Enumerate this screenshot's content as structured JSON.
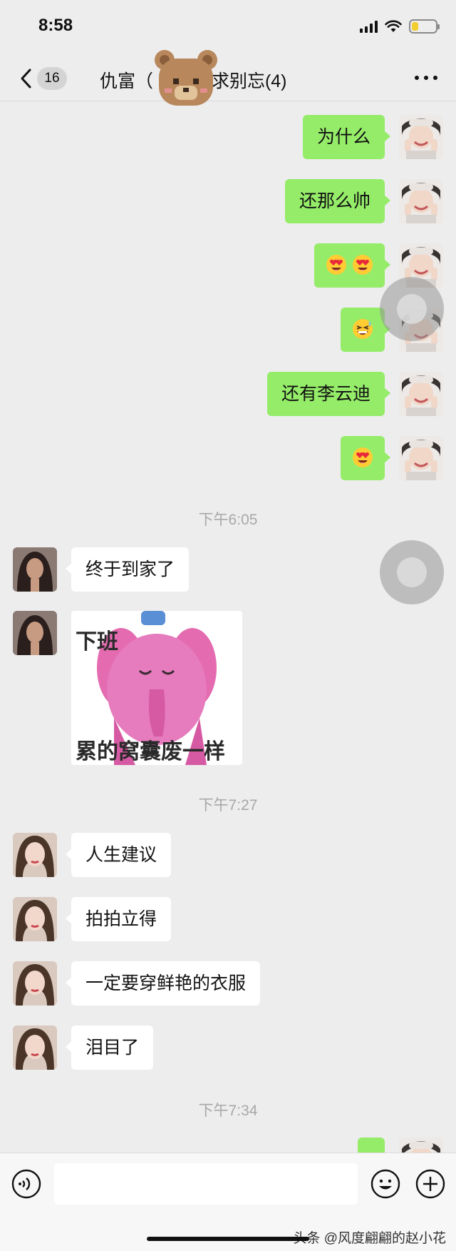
{
  "status_bar": {
    "time": "8:58"
  },
  "nav": {
    "unread_count": "16",
    "title": "仇富（ 签到求求别忘(4)"
  },
  "messages_top": [
    {
      "side": "out",
      "text": "为什么"
    },
    {
      "side": "out",
      "text": "还那么帅"
    },
    {
      "side": "out",
      "emoji": "heart-eyes-emoji x2"
    },
    {
      "side": "out",
      "emoji": "grinning-sweat-emoji"
    },
    {
      "side": "out",
      "text": "还有李云迪"
    },
    {
      "side": "out",
      "emoji": "heart-eyes-emoji"
    }
  ],
  "time_1": "下午6:05",
  "msg_1": "终于到家了",
  "sticker": {
    "top_text": "下班",
    "bottom_text": "累的窝囊废一样"
  },
  "time_2": "下午7:27",
  "msgs_2": [
    "人生建议",
    "拍拍立得",
    "一定要穿鲜艳的衣服",
    "泪目了"
  ],
  "time_3": "下午7:34",
  "input": {
    "placeholder": ""
  },
  "watermark": "头条 @风度翩翩的赵小花",
  "colors": {
    "outgoing_bubble": "#95ec69",
    "incoming_bubble": "#ffffff",
    "background": "#ededed"
  }
}
